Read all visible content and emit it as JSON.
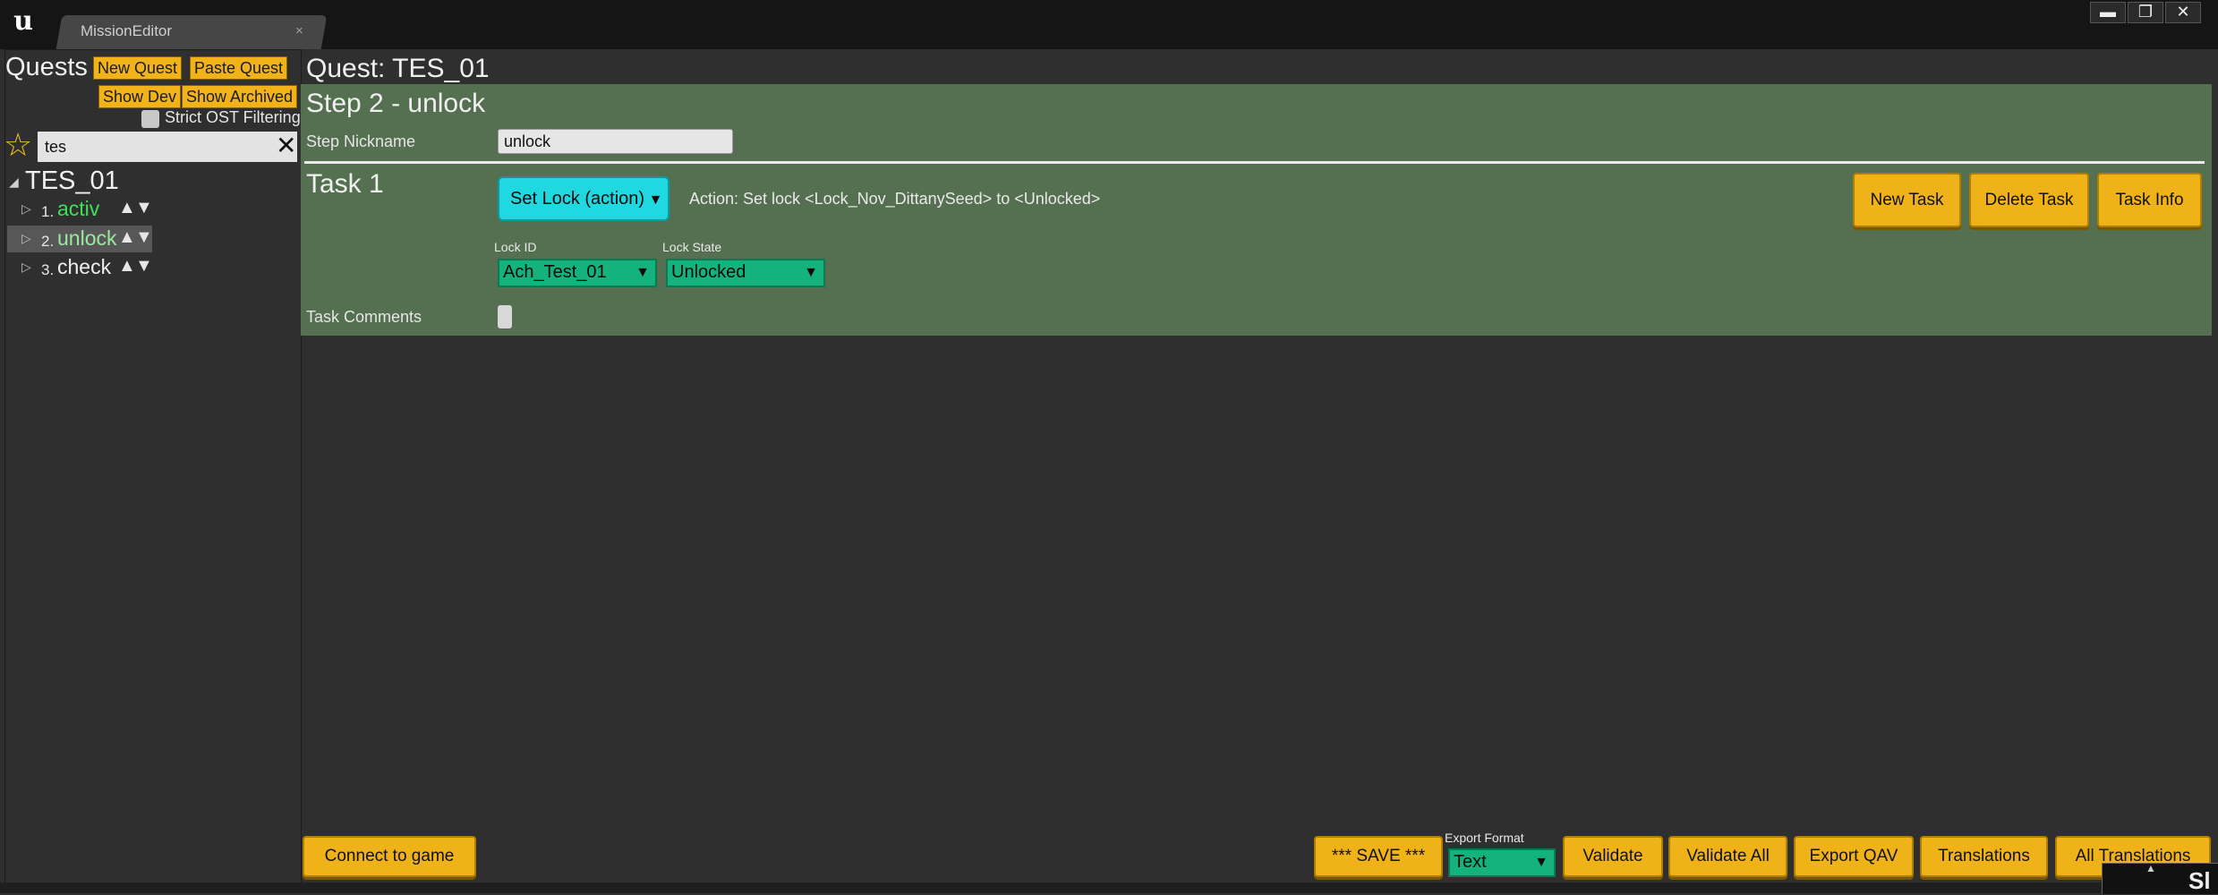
{
  "window": {
    "tab_label": "MissionEditor",
    "tab_close": "×",
    "minimize": "▬",
    "maximize": "❐",
    "close": "✕"
  },
  "left": {
    "title": "Quests",
    "new_quest": "New Quest",
    "paste_quest": "Paste Quest",
    "show_dev": "Show Dev",
    "show_archived": "Show Archived",
    "strict_label": "Strict OST Filtering",
    "search_value": "tes",
    "search_clear": "✕",
    "root": "TES_01",
    "steps": [
      {
        "num": "1.",
        "name": "activ",
        "color": "#3ee05a"
      },
      {
        "num": "2.",
        "name": "unlock",
        "color": "#9be8a0",
        "selected": true
      },
      {
        "num": "3.",
        "name": "check",
        "color": "#f0f0f0"
      }
    ]
  },
  "main": {
    "quest_title": "Quest: TES_01",
    "step_title": "Step 2 - unlock",
    "nickname_label": "Step Nickname",
    "nickname_value": "unlock",
    "task_title": "Task 1",
    "action_select": "Set Lock (action)",
    "action_desc": "Action: Set lock <Lock_Nov_DittanySeed> to <Unlocked>",
    "new_task": "New Task",
    "delete_task": "Delete Task",
    "task_info": "Task Info",
    "lock_id_label": "Lock ID",
    "lock_id_value": "Ach_Test_01",
    "lock_state_label": "Lock State",
    "lock_state_value": "Unlocked",
    "comments_label": "Task Comments"
  },
  "bottom": {
    "connect": "Connect to game",
    "save": "*** SAVE ***",
    "export_label": "Export Format",
    "export_value": "Text",
    "validate": "Validate",
    "validate_all": "Validate All",
    "export_qav": "Export QAV",
    "translations": "Translations",
    "all_translations": "All Translations",
    "corner_text": "Sl"
  },
  "colors": {
    "accent_button": "#f0b219",
    "step_panel": "#557050",
    "teal_select": "#14b27d",
    "cyan_select": "#1fd8e0"
  }
}
